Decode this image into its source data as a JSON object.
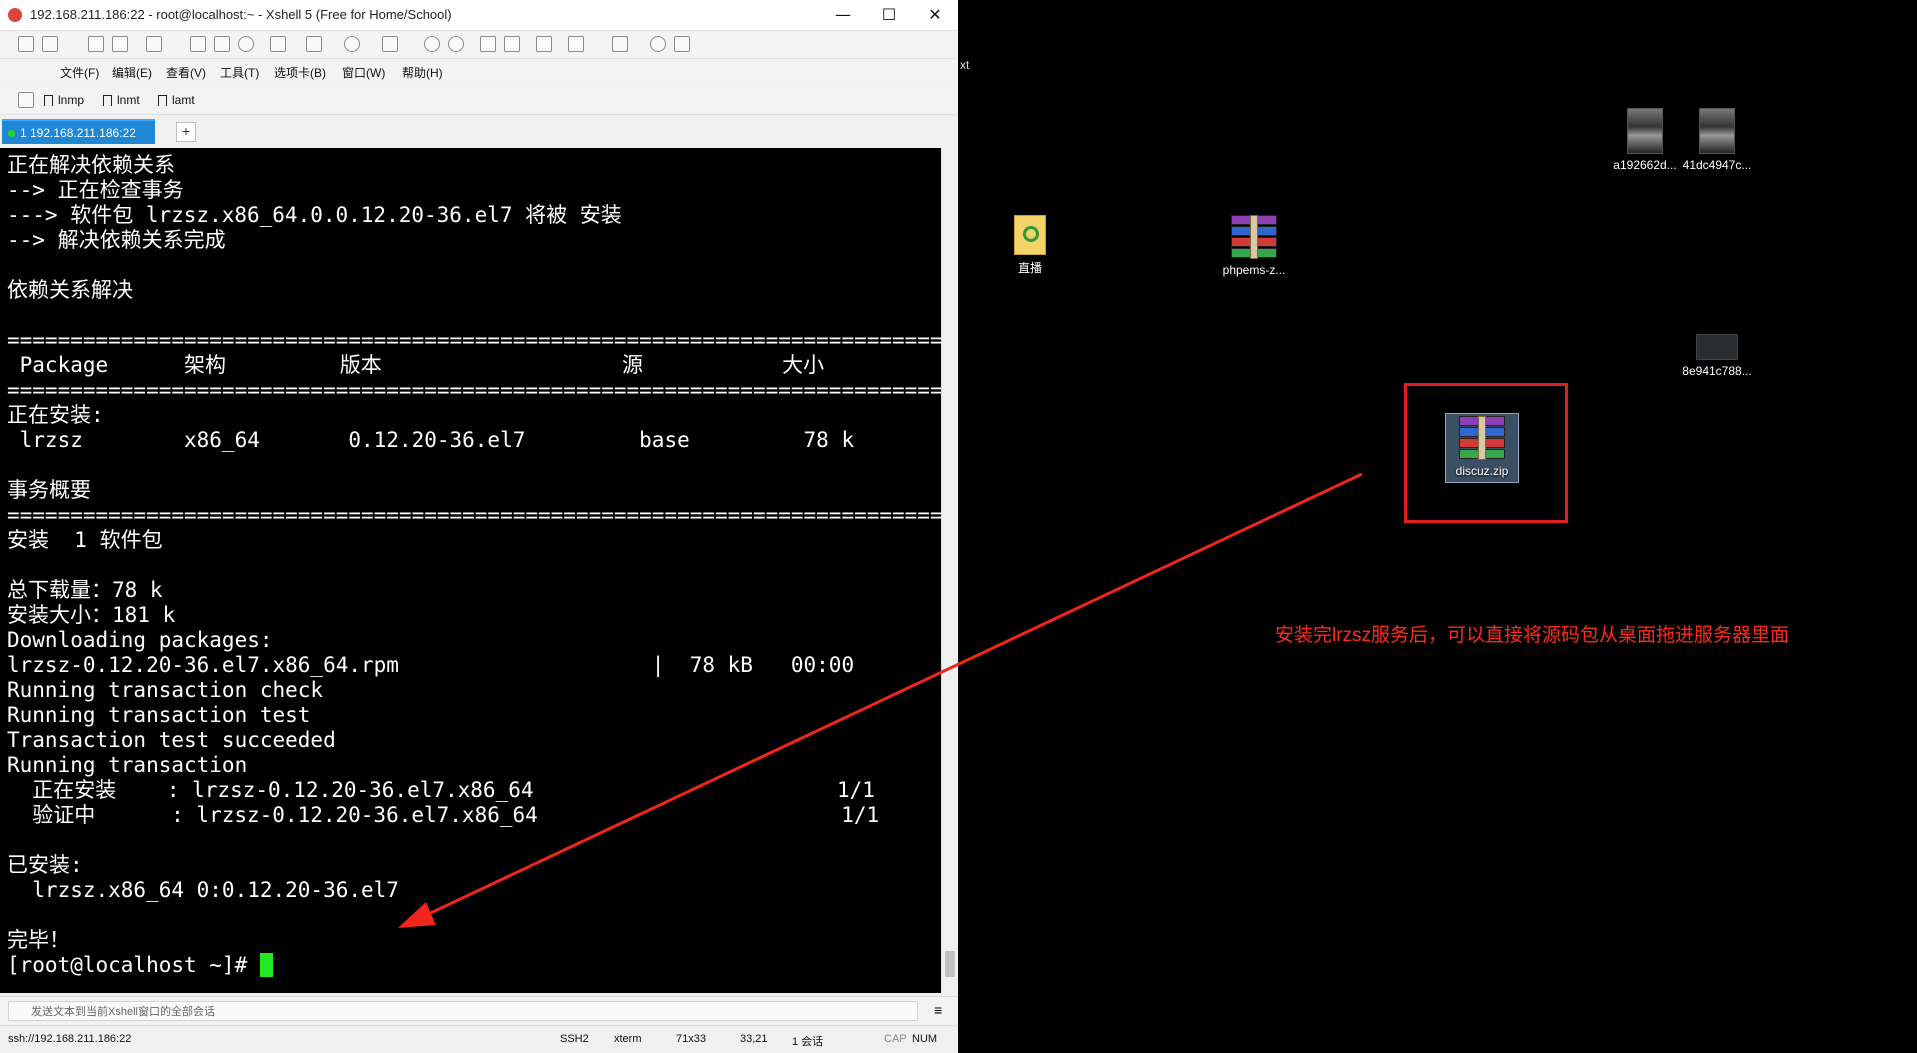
{
  "window": {
    "title": "192.168.211.186:22 - root@localhost:~ - Xshell 5 (Free for Home/School)",
    "minimize": "—",
    "maximize": "☐",
    "close": "✕"
  },
  "menu": [
    "文件(F)",
    "编辑(E)",
    "查看(V)",
    "工具(T)",
    "选项卡(B)",
    "窗口(W)",
    "帮助(H)"
  ],
  "links": [
    "lnmp",
    "lnmt",
    "lamt"
  ],
  "tab": {
    "label": "1 192.168.211.186:22",
    "add": "+"
  },
  "terminal": {
    "lines": [
      "正在解决依赖关系",
      "--> 正在检查事务",
      "---> 软件包 lrzsz.x86_64.0.0.12.20-36.el7 将被 安装",
      "--> 解决依赖关系完成",
      "",
      "依赖关系解决",
      "",
      "==========================================================================",
      " Package      架构         版本                   源           大小",
      "==========================================================================",
      "正在安装:",
      " lrzsz        x86_64       0.12.20-36.el7         base         78 k",
      "",
      "事务概要",
      "==========================================================================",
      "安装  1 软件包",
      "",
      "总下载量：78 k",
      "安装大小：181 k",
      "Downloading packages:",
      "lrzsz-0.12.20-36.el7.x86_64.rpm                    |  78 kB   00:00",
      "Running transaction check",
      "Running transaction test",
      "Transaction test succeeded",
      "Running transaction",
      "  正在安装    : lrzsz-0.12.20-36.el7.x86_64                        1/1",
      "  验证中      : lrzsz-0.12.20-36.el7.x86_64                        1/1",
      "",
      "已安装:",
      "  lrzsz.x86_64 0:0.12.20-36.el7",
      "",
      "完毕！"
    ],
    "prompt": "[root@localhost ~]# "
  },
  "compose": {
    "placeholder": "发送文本到当前Xshell窗口的全部会话"
  },
  "status": {
    "address": "ssh://192.168.211.186:22",
    "protocol": "SSH2",
    "term": "xterm",
    "size": "71x33",
    "cursor": "33,21",
    "sessions": "1 会话",
    "caps": "CAP",
    "num": "NUM"
  },
  "desktop": {
    "partial_text": "xt",
    "icons": [
      {
        "label": "a192662d..."
      },
      {
        "label": "41dc4947c..."
      },
      {
        "label": "直播"
      },
      {
        "label": "phpems-z..."
      },
      {
        "label": "8e941c788..."
      },
      {
        "label": "discuz.zip"
      }
    ]
  },
  "annotation": {
    "text": "安装完lrzsz服务后，可以直接将源码包从桌面拖进服务器里面",
    "color": "#ff2a1a"
  }
}
